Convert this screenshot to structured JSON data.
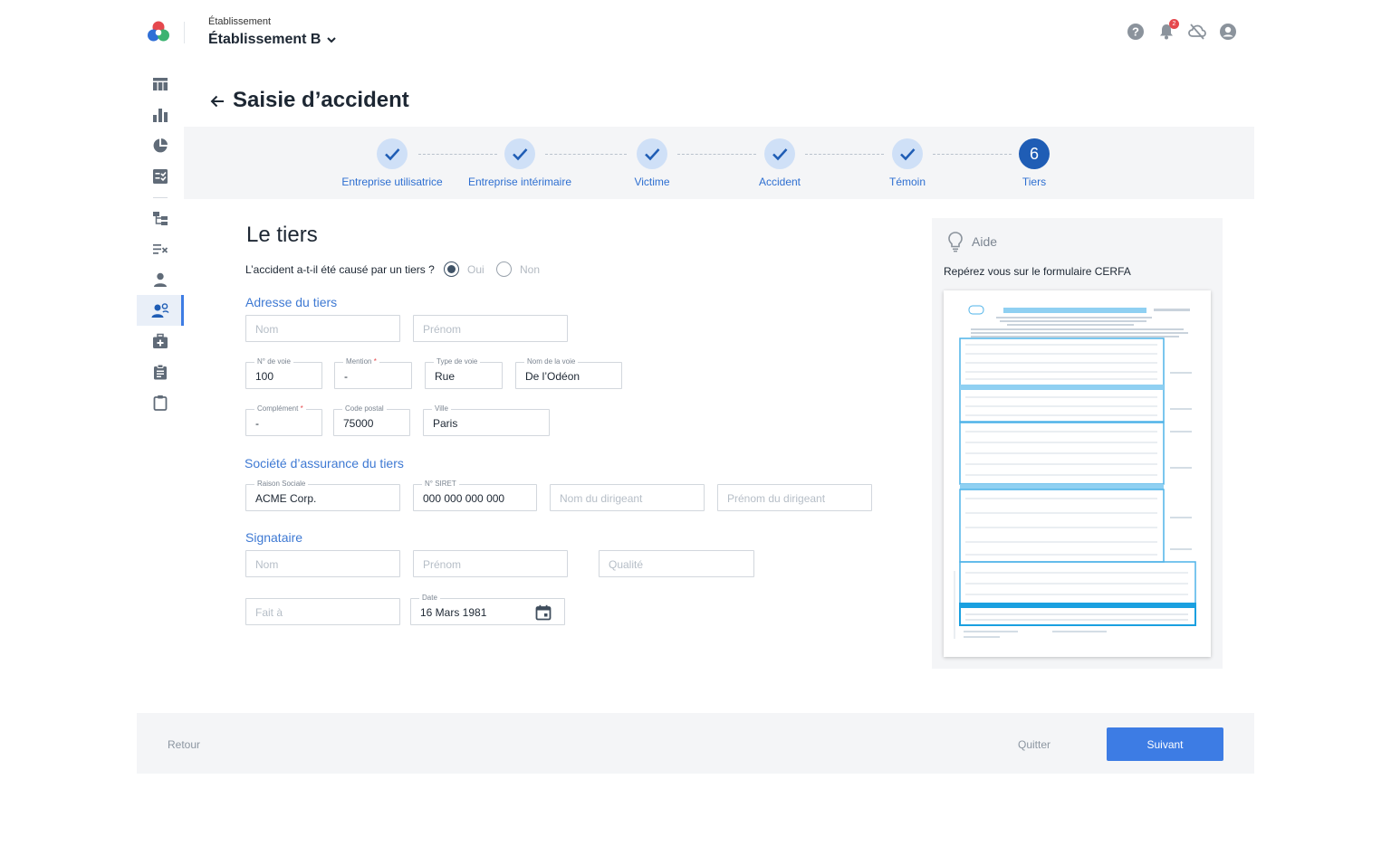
{
  "header": {
    "estab_label": "Établissement",
    "estab_name": "Établissement B",
    "notification_count": "2",
    "icons": [
      "help-icon",
      "bell-icon",
      "cloud-off-icon",
      "account-icon"
    ]
  },
  "sidebar": {
    "items": [
      "table-icon",
      "bar-chart-icon",
      "pie-chart-icon",
      "checklist-icon",
      "org-chart-icon",
      "rules-icon",
      "person-icon",
      "people-icon",
      "medical-kit-icon",
      "clipboard-icon",
      "clipboard-outline-icon"
    ],
    "active_index": 7
  },
  "page": {
    "title": "Saisie d’accident"
  },
  "stepper": {
    "steps": [
      {
        "label": "Entreprise utilisatrice",
        "done": true
      },
      {
        "label": "Entreprise intérimaire",
        "done": true
      },
      {
        "label": "Victime",
        "done": true
      },
      {
        "label": "Accident",
        "done": true
      },
      {
        "label": "Témoin",
        "done": true
      },
      {
        "label": "Tiers",
        "done": false,
        "number": "6"
      }
    ]
  },
  "form": {
    "title": "Le tiers",
    "question": "L’accident a-t-il été causé par un tiers ?",
    "radio_yes": "Oui",
    "radio_no": "Non",
    "radio_selected": "Oui",
    "address_section": "Adresse du tiers",
    "address": {
      "nom_placeholder": "Nom",
      "prenom_placeholder": "Prénom",
      "num_voie_label": "N° de voie",
      "num_voie": "100",
      "mention_label": "Mention",
      "mention": "-",
      "type_voie_label": "Type de voie",
      "type_voie": "Rue",
      "nom_voie_label": "Nom de la voie",
      "nom_voie": "De l’Odéon",
      "complement_label": "Complément",
      "complement": "-",
      "code_postal_label": "Code postal",
      "code_postal": "75000",
      "ville_label": "Ville",
      "ville": "Paris"
    },
    "insurance_section": "Société d’assurance du tiers",
    "insurance": {
      "raison_label": "Raison Sociale",
      "raison": "ACME Corp.",
      "siret_label": "N° SIRET",
      "siret": "000 000 000 000",
      "dirigeant_nom_placeholder": "Nom du dirigeant",
      "dirigeant_prenom_placeholder": "Prénom du dirigeant"
    },
    "signataire_section": "Signataire",
    "signataire": {
      "nom_placeholder": "Nom",
      "prenom_placeholder": "Prénom",
      "qualite_placeholder": "Qualité",
      "fait_a_placeholder": "Fait à",
      "date_label": "Date",
      "date": "16 Mars 1981"
    }
  },
  "help": {
    "title": "Aide",
    "subtitle": "Repérez vous sur le formulaire CERFA"
  },
  "footer": {
    "retour": "Retour",
    "quitter": "Quitter",
    "suivant": "Suivant"
  },
  "colors": {
    "accent": "#3d7ce4",
    "step_current": "#1f5db5",
    "step_done_bg": "#cfe0f7",
    "panel_bg": "#f4f5f7",
    "cerfa_blue": "#4fb3e8"
  }
}
